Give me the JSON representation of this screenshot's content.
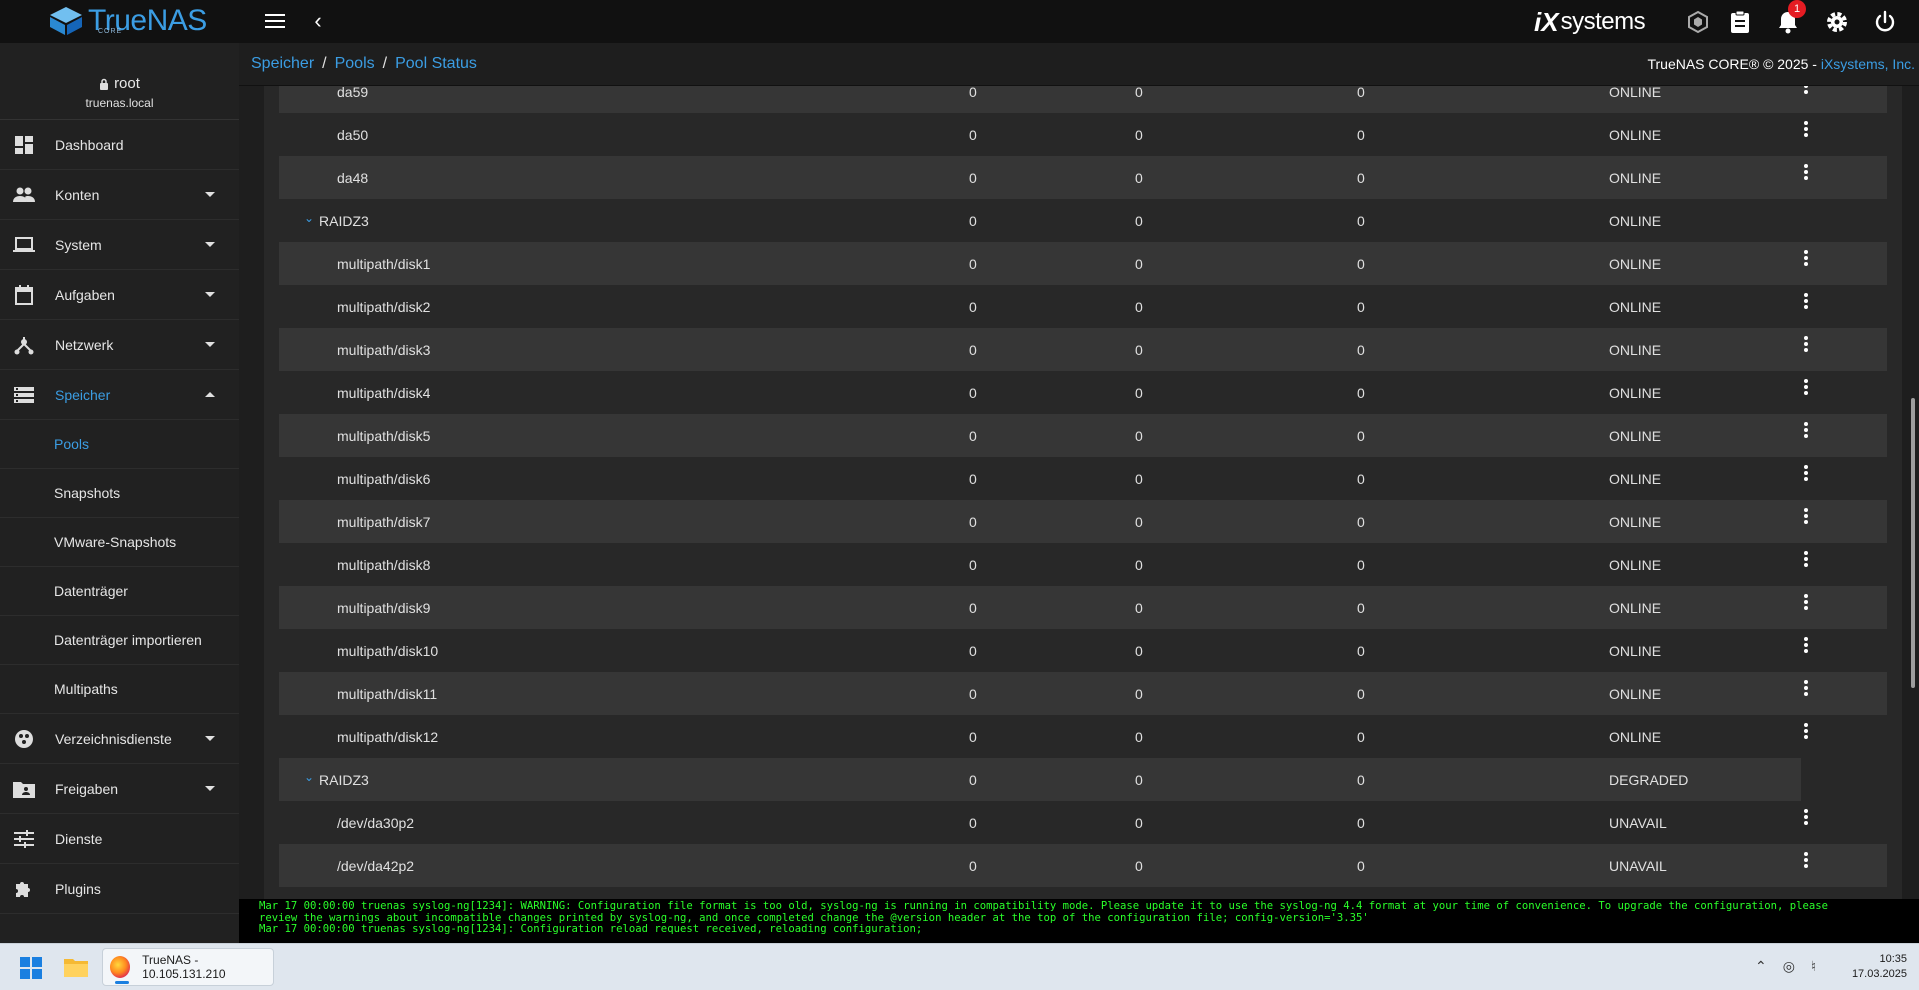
{
  "topbar": {
    "logo_text": "TrueNAS",
    "logo_sub": "CORE",
    "vendor_ix": "iX",
    "vendor_systems": "systems",
    "notification_count": "1"
  },
  "sidebar": {
    "user": "root",
    "host": "truenas.local",
    "items": [
      {
        "label": "Dashboard",
        "icon": "dashboard-icon"
      },
      {
        "label": "Konten",
        "icon": "people-icon"
      },
      {
        "label": "System",
        "icon": "laptop-icon"
      },
      {
        "label": "Aufgaben",
        "icon": "calendar-icon"
      },
      {
        "label": "Netzwerk",
        "icon": "network-icon"
      },
      {
        "label": "Speicher",
        "icon": "storage-icon"
      },
      {
        "label": "Verzeichnisdienste",
        "icon": "directory-icon"
      },
      {
        "label": "Freigaben",
        "icon": "folder-share-icon"
      },
      {
        "label": "Dienste",
        "icon": "tune-icon"
      },
      {
        "label": "Plugins",
        "icon": "puzzle-icon"
      }
    ],
    "storage_sub": [
      "Pools",
      "Snapshots",
      "VMware-Snapshots",
      "Datenträger",
      "Datenträger importieren",
      "Multipaths"
    ]
  },
  "breadcrumb": {
    "items": [
      "Speicher",
      "Pools",
      "Pool Status"
    ],
    "copyright_prefix": "TrueNAS CORE® © 2025 - ",
    "copyright_link": "iXsystems, Inc."
  },
  "pool_rows": [
    {
      "name": "da59",
      "read": "0",
      "write": "0",
      "checksum": "0",
      "status": "ONLINE",
      "type": "disk"
    },
    {
      "name": "da50",
      "read": "0",
      "write": "0",
      "checksum": "0",
      "status": "ONLINE",
      "type": "disk"
    },
    {
      "name": "da48",
      "read": "0",
      "write": "0",
      "checksum": "0",
      "status": "ONLINE",
      "type": "disk"
    },
    {
      "name": "RAIDZ3",
      "read": "0",
      "write": "0",
      "checksum": "0",
      "status": "ONLINE",
      "type": "vdev"
    },
    {
      "name": "multipath/disk1",
      "read": "0",
      "write": "0",
      "checksum": "0",
      "status": "ONLINE",
      "type": "disk"
    },
    {
      "name": "multipath/disk2",
      "read": "0",
      "write": "0",
      "checksum": "0",
      "status": "ONLINE",
      "type": "disk"
    },
    {
      "name": "multipath/disk3",
      "read": "0",
      "write": "0",
      "checksum": "0",
      "status": "ONLINE",
      "type": "disk"
    },
    {
      "name": "multipath/disk4",
      "read": "0",
      "write": "0",
      "checksum": "0",
      "status": "ONLINE",
      "type": "disk"
    },
    {
      "name": "multipath/disk5",
      "read": "0",
      "write": "0",
      "checksum": "0",
      "status": "ONLINE",
      "type": "disk"
    },
    {
      "name": "multipath/disk6",
      "read": "0",
      "write": "0",
      "checksum": "0",
      "status": "ONLINE",
      "type": "disk"
    },
    {
      "name": "multipath/disk7",
      "read": "0",
      "write": "0",
      "checksum": "0",
      "status": "ONLINE",
      "type": "disk"
    },
    {
      "name": "multipath/disk8",
      "read": "0",
      "write": "0",
      "checksum": "0",
      "status": "ONLINE",
      "type": "disk"
    },
    {
      "name": "multipath/disk9",
      "read": "0",
      "write": "0",
      "checksum": "0",
      "status": "ONLINE",
      "type": "disk"
    },
    {
      "name": "multipath/disk10",
      "read": "0",
      "write": "0",
      "checksum": "0",
      "status": "ONLINE",
      "type": "disk"
    },
    {
      "name": "multipath/disk11",
      "read": "0",
      "write": "0",
      "checksum": "0",
      "status": "ONLINE",
      "type": "disk"
    },
    {
      "name": "multipath/disk12",
      "read": "0",
      "write": "0",
      "checksum": "0",
      "status": "ONLINE",
      "type": "disk"
    },
    {
      "name": "RAIDZ3",
      "read": "0",
      "write": "0",
      "checksum": "0",
      "status": "DEGRADED",
      "type": "vdev"
    },
    {
      "name": "/dev/da30p2",
      "read": "0",
      "write": "0",
      "checksum": "0",
      "status": "UNAVAIL",
      "type": "disk"
    },
    {
      "name": "/dev/da42p2",
      "read": "0",
      "write": "0",
      "checksum": "0",
      "status": "UNAVAIL",
      "type": "disk"
    }
  ],
  "console": {
    "line1": "Mar 17 00:00:00 truenas syslog-ng[1234]: WARNING: Configuration file format is too old, syslog-ng is running in compatibility mode. Please update it to use the syslog-ng 4.4 format at your time of convenience. To upgrade the configuration, please",
    "line2": "review the warnings about incompatible changes printed by syslog-ng, and once completed change the @version header at the top of the configuration file; config-version='3.35'",
    "line3": "Mar 17 00:00:00 truenas syslog-ng[1234]: Configuration reload request received, reloading configuration;"
  },
  "taskbar": {
    "app_title": "TrueNAS - 10.105.131.210",
    "time": "10:35",
    "date": "17.03.2025"
  },
  "colors": {
    "accent": "#3b9de3",
    "console_text": "#2aff2a",
    "badge": "#e51c23"
  }
}
